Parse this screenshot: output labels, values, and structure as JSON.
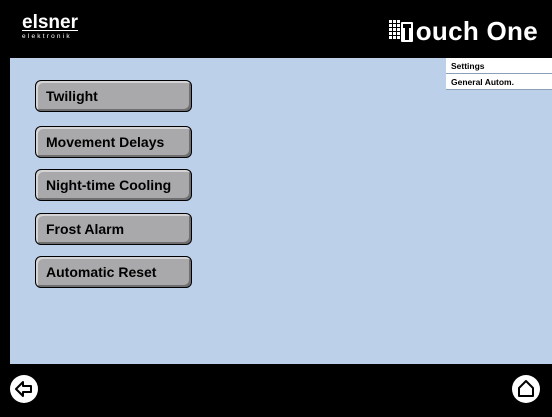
{
  "header": {
    "brand_name": "elsner",
    "brand_sub": "elektronik",
    "product_icon": "building-grid-icon",
    "product_name": "ouch One"
  },
  "breadcrumbs": [
    "Settings",
    "General Autom."
  ],
  "menu": [
    {
      "label": "Twilight"
    },
    {
      "label": "Movement Delays"
    },
    {
      "label": "Night-time Cooling"
    },
    {
      "label": "Frost Alarm"
    },
    {
      "label": "Automatic Reset"
    }
  ],
  "footer": {
    "back_icon": "back-arrow-icon",
    "home_icon": "home-icon"
  },
  "colors": {
    "background": "#000000",
    "panel": "#bdd0ea",
    "button": "#a9a9ab"
  }
}
